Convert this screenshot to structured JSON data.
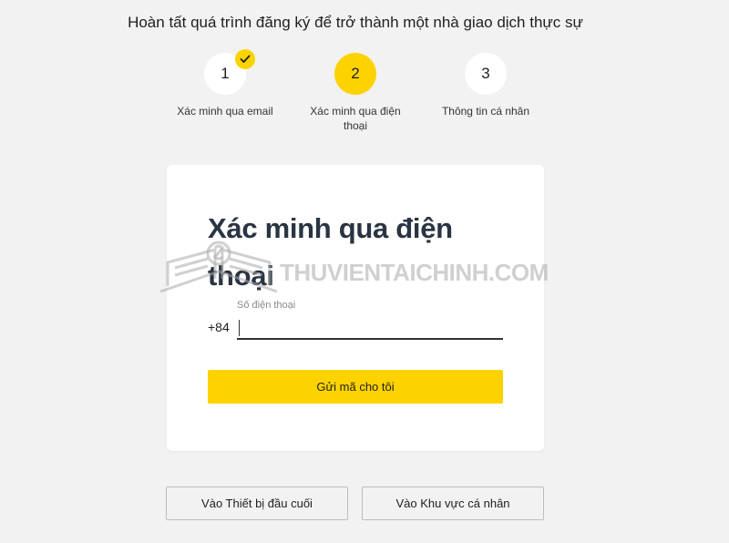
{
  "heading": "Hoàn tất quá trình đăng ký để trở thành một nhà giao dịch thực sự",
  "steps": [
    {
      "number": "1",
      "label": "Xác minh qua email",
      "state": "completed"
    },
    {
      "number": "2",
      "label": "Xác minh qua điện thoại",
      "state": "active"
    },
    {
      "number": "3",
      "label": "Thông tin cá nhân",
      "state": "pending"
    }
  ],
  "card": {
    "title": "Xác minh qua điện thoại",
    "phone_label": "Số điện thoại",
    "country_code": "+84",
    "phone_value": "",
    "send_button": "Gửi mã cho tôi"
  },
  "watermark": "THUVIENTAICHINH.COM",
  "footer": {
    "terminal_button": "Vào Thiết bị đầu cuối",
    "personal_button": "Vào Khu vực cá nhân"
  },
  "colors": {
    "accent": "#fcd300",
    "background": "#f2f2f2",
    "title": "#2a3442"
  }
}
